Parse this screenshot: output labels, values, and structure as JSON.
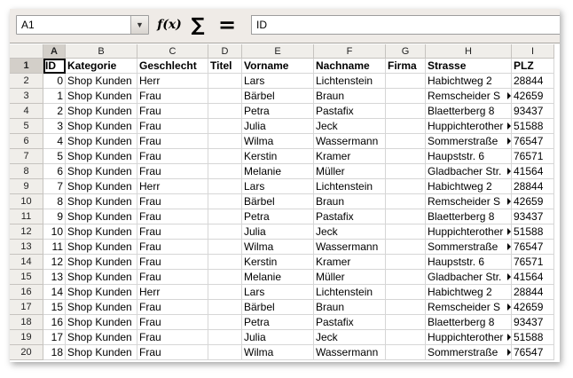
{
  "name_box": {
    "value": "A1"
  },
  "formula_bar": {
    "function_wizard": "f(x)",
    "sum_symbol": "∑",
    "equals_symbol": "=",
    "input_value": "ID"
  },
  "columns": [
    "A",
    "B",
    "C",
    "D",
    "E",
    "F",
    "G",
    "H",
    "I"
  ],
  "active_column": "A",
  "active_row": "1",
  "header_row": {
    "row_label": "1",
    "cells": [
      "ID",
      "Kategorie",
      "Geschlecht",
      "Titel",
      "Vorname",
      "Nachname",
      "Firma",
      "Strasse",
      "PLZ"
    ]
  },
  "rows": [
    {
      "row_label": "2",
      "cells": [
        "0",
        "Shop Kunden",
        "Herr",
        "",
        "Lars",
        "Lichtenstein",
        "",
        "Habichtweg 2",
        "28844"
      ]
    },
    {
      "row_label": "3",
      "cells": [
        "1",
        "Shop Kunden",
        "Frau",
        "",
        "Bärbel",
        "Braun",
        "",
        "Remscheider S",
        "42659"
      ]
    },
    {
      "row_label": "4",
      "cells": [
        "2",
        "Shop Kunden",
        "Frau",
        "",
        "Petra",
        "Pastafix",
        "",
        "Blaetterberg   8",
        "93437"
      ]
    },
    {
      "row_label": "5",
      "cells": [
        "3",
        "Shop Kunden",
        "Frau",
        "",
        "Julia",
        "Jeck",
        "",
        "Huppichterother",
        "51588"
      ]
    },
    {
      "row_label": "6",
      "cells": [
        "4",
        "Shop Kunden",
        "Frau",
        "",
        "Wilma",
        "Wassermann",
        "",
        "Sommerstraße",
        "76547"
      ]
    },
    {
      "row_label": "7",
      "cells": [
        "5",
        "Shop Kunden",
        "Frau",
        "",
        "Kerstin",
        "Kramer",
        "",
        "Haupststr. 6",
        "76571"
      ]
    },
    {
      "row_label": "8",
      "cells": [
        "6",
        "Shop Kunden",
        "Frau",
        "",
        "Melanie",
        "Müller",
        "",
        "Gladbacher Str.",
        "41564"
      ]
    },
    {
      "row_label": "9",
      "cells": [
        "7",
        "Shop Kunden",
        "Herr",
        "",
        "Lars",
        "Lichtenstein",
        "",
        "Habichtweg 2",
        "28844"
      ]
    },
    {
      "row_label": "10",
      "cells": [
        "8",
        "Shop Kunden",
        "Frau",
        "",
        "Bärbel",
        "Braun",
        "",
        "Remscheider S",
        "42659"
      ]
    },
    {
      "row_label": "11",
      "cells": [
        "9",
        "Shop Kunden",
        "Frau",
        "",
        "Petra",
        "Pastafix",
        "",
        "Blaetterberg   8",
        "93437"
      ]
    },
    {
      "row_label": "12",
      "cells": [
        "10",
        "Shop Kunden",
        "Frau",
        "",
        "Julia",
        "Jeck",
        "",
        "Huppichterother",
        "51588"
      ]
    },
    {
      "row_label": "13",
      "cells": [
        "11",
        "Shop Kunden",
        "Frau",
        "",
        "Wilma",
        "Wassermann",
        "",
        "Sommerstraße",
        "76547"
      ]
    },
    {
      "row_label": "14",
      "cells": [
        "12",
        "Shop Kunden",
        "Frau",
        "",
        "Kerstin",
        "Kramer",
        "",
        "Haupststr. 6",
        "76571"
      ]
    },
    {
      "row_label": "15",
      "cells": [
        "13",
        "Shop Kunden",
        "Frau",
        "",
        "Melanie",
        "Müller",
        "",
        "Gladbacher Str.",
        "41564"
      ]
    },
    {
      "row_label": "16",
      "cells": [
        "14",
        "Shop Kunden",
        "Herr",
        "",
        "Lars",
        "Lichtenstein",
        "",
        "Habichtweg 2",
        "28844"
      ]
    },
    {
      "row_label": "17",
      "cells": [
        "15",
        "Shop Kunden",
        "Frau",
        "",
        "Bärbel",
        "Braun",
        "",
        "Remscheider S",
        "42659"
      ]
    },
    {
      "row_label": "18",
      "cells": [
        "16",
        "Shop Kunden",
        "Frau",
        "",
        "Petra",
        "Pastafix",
        "",
        "Blaetterberg   8",
        "93437"
      ]
    },
    {
      "row_label": "19",
      "cells": [
        "17",
        "Shop Kunden",
        "Frau",
        "",
        "Julia",
        "Jeck",
        "",
        "Huppichterother",
        "51588"
      ]
    },
    {
      "row_label": "20",
      "cells": [
        "18",
        "Shop Kunden",
        "Frau",
        "",
        "Wilma",
        "Wassermann",
        "",
        "Sommerstraße",
        "76547"
      ]
    }
  ],
  "overflow_columns": [
    "H"
  ]
}
